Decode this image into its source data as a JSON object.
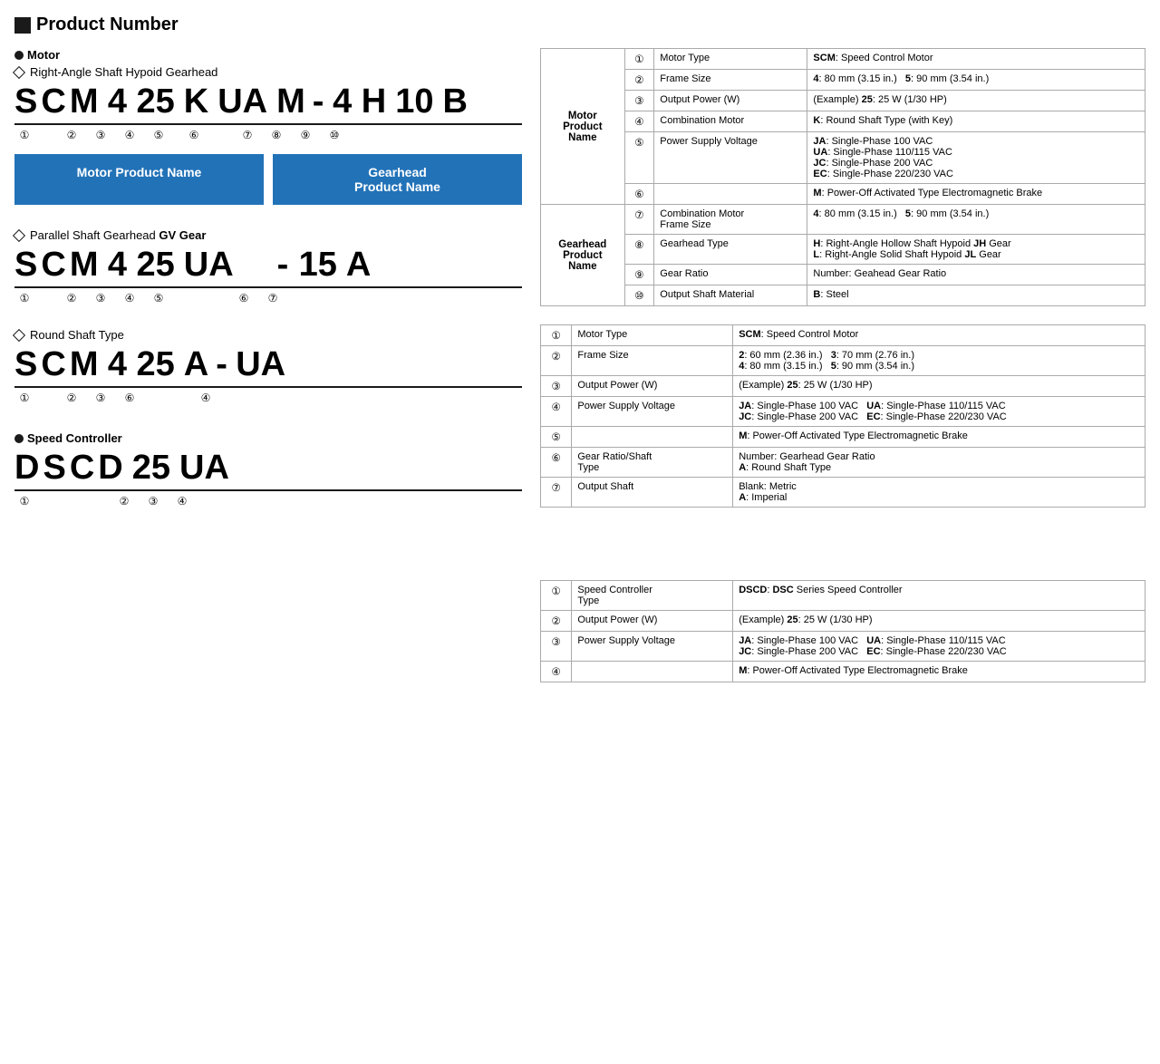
{
  "page": {
    "title": "Product Number"
  },
  "motor_section": {
    "label": "Motor",
    "right_angle_label": "Right-Angle Shaft Hypoid Gearhead",
    "code_chars": [
      "S",
      "C",
      "M",
      "4",
      "25",
      "K",
      "UA",
      "M",
      "-",
      "4",
      "H",
      "10",
      "B"
    ],
    "code_nums": [
      "①",
      "②",
      "③",
      "④",
      "⑤",
      "⑥",
      "",
      "⑦",
      "⑧",
      "⑨",
      "⑩"
    ],
    "blue_box_motor": "Motor Product Name",
    "blue_box_gearhead": "Gearhead\nProduct Name",
    "parallel_label": "Parallel Shaft Gearhead GV Gear",
    "parallel_code": [
      "S",
      "C",
      "M",
      "4",
      "25",
      "UA",
      "",
      "-",
      "15",
      "A"
    ],
    "parallel_nums": [
      "①",
      "②",
      "③",
      "④",
      "⑤",
      "",
      "⑥",
      "⑦"
    ],
    "round_label": "Round Shaft Type",
    "round_code": [
      "S",
      "C",
      "M",
      "4",
      "25",
      "A",
      "-",
      "UA"
    ],
    "round_nums": [
      "①",
      "②",
      "③",
      "⑥",
      "④"
    ]
  },
  "speed_controller": {
    "label": "Speed Controller",
    "code": [
      "D",
      "S",
      "C",
      "D",
      "25",
      "UA"
    ],
    "nums": [
      "①",
      "",
      "②",
      "③",
      "④"
    ]
  },
  "table1": {
    "group_labels": [
      "Motor\nProduct\nName",
      "",
      "",
      "",
      "",
      "",
      "Gearhead\nProduct\nName",
      "",
      "",
      ""
    ],
    "rows": [
      {
        "num": "①",
        "field": "Motor Type",
        "desc": "<b>SCM</b>: Speed Control Motor",
        "rowspan": 0
      },
      {
        "num": "②",
        "field": "Frame Size",
        "desc": "<b>4</b>: 80 mm (3.15 in.)    <b>5</b>: 90 mm (3.54 in.)",
        "rowspan": 0
      },
      {
        "num": "③",
        "field": "Output Power (W)",
        "desc": "(Example) <b>25</b>: 25 W (1/30 HP)",
        "rowspan": 0
      },
      {
        "num": "④",
        "field": "Combination Motor",
        "desc": "<b>K</b>: Round Shaft Type (with Key)",
        "rowspan": 0
      },
      {
        "num": "⑤",
        "field": "Power Supply Voltage",
        "desc": "<b>JA</b>: Single-Phase 100 VAC\n<b>UA</b>: Single-Phase 110/115 VAC\n<b>JC</b>: Single-Phase 200 VAC\n<b>EC</b>: Single-Phase 220/230 VAC",
        "rowspan": 0
      },
      {
        "num": "⑥",
        "field": "",
        "desc": "<b>M</b>: Power-Off Activated Type Electromagnetic Brake",
        "rowspan": 0
      },
      {
        "num": "⑦",
        "field": "Combination Motor Frame Size",
        "desc": "<b>4</b>: 80 mm (3.15 in.)    <b>5</b>: 90 mm (3.54 in.)",
        "rowspan": 0
      },
      {
        "num": "⑧",
        "field": "Gearhead Type",
        "desc": "<b>H</b>: Right-Angle Hollow Shaft Hypoid <b>JH</b> Gear\n<b>L</b>: Right-Angle Solid Shaft Hypoid <b>JL</b> Gear",
        "rowspan": 0
      },
      {
        "num": "⑨",
        "field": "Gear Ratio",
        "desc": "Number: Geahead Gear Ratio",
        "rowspan": 0
      },
      {
        "num": "⑩",
        "field": "Output Shaft Material",
        "desc": "<b>B</b>: Steel",
        "rowspan": 0
      }
    ]
  },
  "table2": {
    "rows": [
      {
        "num": "①",
        "field": "Motor Type",
        "desc": "<b>SCM</b>: Speed Control Motor"
      },
      {
        "num": "②",
        "field": "Frame Size",
        "desc": "<b>2</b>: 60 mm (2.36 in.)    <b>3</b>: 70 mm (2.76 in.)\n<b>4</b>: 80 mm (3.15 in.)    <b>5</b>: 90 mm (3.54 in.)"
      },
      {
        "num": "③",
        "field": "Output Power (W)",
        "desc": "(Example) <b>25</b>: 25 W (1/30 HP)"
      },
      {
        "num": "④",
        "field": "Power Supply Voltage",
        "desc": "<b>JA</b>: Single-Phase 100 VAC    <b>UA</b>: Single-Phase 110/115 VAC\n<b>JC</b>: Single-Phase 200 VAC    <b>EC</b>: Single-Phase 220/230 VAC"
      },
      {
        "num": "⑤",
        "field": "",
        "desc": "<b>M</b>: Power-Off Activated Type Electromagnetic Brake"
      },
      {
        "num": "⑥",
        "field": "Gear Ratio/Shaft Type",
        "desc": "Number: Gearhead Gear Ratio\n<b>A</b>: Round Shaft Type"
      },
      {
        "num": "⑦",
        "field": "Output Shaft",
        "desc": "Blank: Metric\n<b>A</b>: Imperial"
      }
    ]
  },
  "table3": {
    "rows": [
      {
        "num": "①",
        "field": "Speed Controller Type",
        "desc": "<b>DSCD</b>: <b>DSC</b> Series Speed Controller"
      },
      {
        "num": "②",
        "field": "Output Power (W)",
        "desc": "(Example) <b>25</b>: 25 W (1/30 HP)"
      },
      {
        "num": "③",
        "field": "Power Supply Voltage",
        "desc": "<b>JA</b>: Single-Phase 100 VAC    <b>UA</b>: Single-Phase 110/115 VAC\n<b>JC</b>: Single-Phase 200 VAC    <b>EC</b>: Single-Phase 220/230 VAC"
      },
      {
        "num": "④",
        "field": "",
        "desc": "<b>M</b>: Power-Off Activated Type Electromagnetic Brake"
      }
    ]
  }
}
